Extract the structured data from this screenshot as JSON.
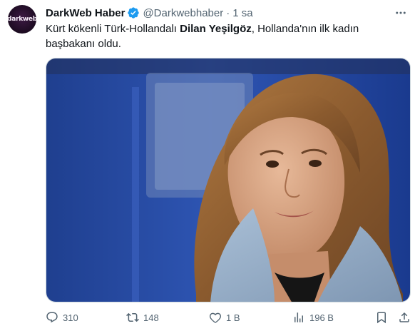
{
  "author": {
    "avatar_text": "darkweb",
    "display_name": "DarkWeb Haber",
    "handle": "@Darkwebhaber",
    "separator": "·",
    "time": "1 sa"
  },
  "tweet": {
    "text_before": "Kürt kökenli Türk-Hollandalı ",
    "text_bold": "Dilan Yeşilgöz",
    "text_after": ", Hollanda'nın ilk kadın başbakanı oldu."
  },
  "actions": {
    "replies": "310",
    "retweets": "148",
    "likes": "1 B",
    "views": "196 B"
  },
  "colors": {
    "verified": "#1d9bf0",
    "muted": "#536471",
    "text": "#0f1419"
  },
  "icons": [
    "verified-icon",
    "more-icon",
    "reply-icon",
    "retweet-icon",
    "like-icon",
    "views-icon",
    "bookmark-icon",
    "share-icon"
  ]
}
